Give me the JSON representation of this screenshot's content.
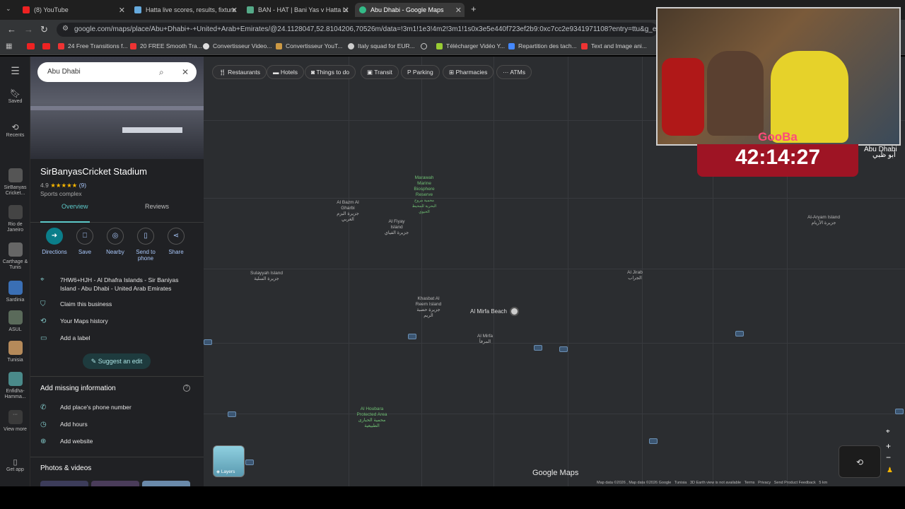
{
  "tabs": [
    {
      "title": "(8) YouTube",
      "color": "#e22"
    },
    {
      "title": "Hatta live scores, results, fixture",
      "color": "#6ad"
    },
    {
      "title": "BAN - HAT | Bani Yas v Hatta Li",
      "color": "#5a8"
    },
    {
      "title": "Abu Dhabi - Google Maps",
      "color": "#3b8"
    }
  ],
  "url": "google.com/maps/place/Abu+Dhabi+-+United+Arab+Emirates/@24.1128047,52.8104206,70526m/data=!3m1!1e3!4m2!3m1!1s0x3e5e440f723ef2b9:0xc7cc2e9341971108?entry=ttu&g_ep=EgoyMDI",
  "bookmarks": [
    "24 Free Transitions f...",
    "20 FREE Smooth Tra...",
    "Convertisseur Video...",
    "Convertisseur YouT...",
    "Italy squad for EUR...",
    "Télécharger Vidéo Y...",
    "Repartition des tach...",
    "Text and Image ani..."
  ],
  "rail": {
    "saved": "Saved",
    "recents": "Recents",
    "items": [
      "SirBanyas Cricket...",
      "Rio de Janeiro",
      "Carthage & Tunis",
      "Sardinia",
      "ASUL",
      "Tunisia",
      "Enfidha-Hamma...",
      "View more"
    ],
    "getapp": "Get app"
  },
  "search": {
    "value": "Abu Dhabi"
  },
  "place": {
    "name": "SirBanyasCricket Stadium",
    "rating": "4.9",
    "stars": "★★★★★",
    "reviews": "(9)",
    "category": "Sports complex",
    "tabs": [
      "Overview",
      "Reviews"
    ],
    "actions": [
      "Directions",
      "Save",
      "Nearby",
      "Send to phone",
      "Share"
    ],
    "address": "7HW6+HJH - Al Dhafra Islands - Sir Baniyas Island - Abu Dhabi - United Arab Emirates",
    "claim": "Claim this business",
    "history": "Your Maps history",
    "label": "Add a label",
    "suggest": "Suggest an edit",
    "missing_title": "Add missing information",
    "missing": [
      "Add place's phone number",
      "Add hours",
      "Add website"
    ],
    "photos": "Photos & videos"
  },
  "chips": [
    "Restaurants",
    "Hotels",
    "Things to do",
    "Transit",
    "Parking",
    "Pharmacies",
    "ATMs"
  ],
  "map_labels": {
    "marawah": "Marawah Marine Biosphere Reserve",
    "marawah_ar": "محمية مروح البحرية للمحيط الحيوي",
    "bazm": "Al Bazm Al Gharbi",
    "bazm_ar": "جزيرة البزم الغربي",
    "fiyay": "Al Fiyay Island",
    "fiyay_ar": "جزيرة الفياي",
    "sulayyah": "Sulayyah Island",
    "sulayyah_ar": "جزيرة السلية",
    "khasbat": "Khasbat Al Reem Island",
    "khasbat_ar": "جزيرة حصبة الريم",
    "mirfa_beach": "Al Mirfa Beach",
    "mirfa": "Al Mirfa",
    "mirfa_ar": "المرفأ",
    "jirab": "Al Jirab",
    "jirab_ar": "الجراب",
    "aryam": "Al-Aryam Island",
    "aryam_ar": "جزيرة الأريام",
    "houbara": "Al Houbara Protected Area",
    "houbara_ar": "محمية الحبارى الطبيعية",
    "abudhabi": "Abu Dhabi",
    "abudhabi_ar": "أبو ظبي"
  },
  "map_footer": {
    "brand": "Google Maps",
    "layers": "Layers",
    "attribution": "Map data ©2026 , Map data ©2026 Google   Tunisia   3D Earth view is not available   Terms   Privacy   Send Product Feedback   5 km"
  },
  "stream": {
    "name": "GooBa",
    "timer": "42:14:27"
  }
}
